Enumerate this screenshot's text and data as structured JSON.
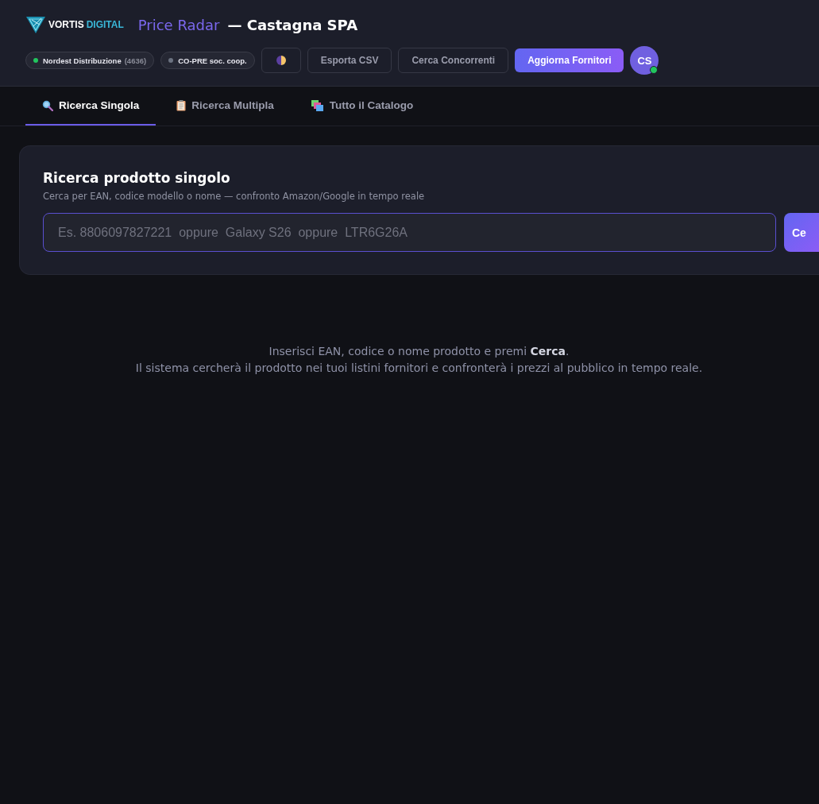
{
  "header": {
    "logo_text": [
      "VORTIS",
      "DIGITAL"
    ],
    "app_name": "Price Radar",
    "title_suffix": "— Castagna SPA",
    "suppliers": [
      {
        "name": "Nordest Distribuzione",
        "count": "(4636)",
        "color": "#22c55e"
      },
      {
        "name": "CO-PRE soc. coop.",
        "color": "#6b7280"
      }
    ],
    "actions": [
      {
        "kind": "theme"
      },
      {
        "kind": "outline",
        "label": "Esporta CSV"
      },
      {
        "kind": "outline",
        "label": "Cerca Concorrenti"
      },
      {
        "kind": "primary",
        "label": "Aggiorna Fornitori"
      }
    ],
    "avatar": {
      "initials": "CS",
      "online": true
    }
  },
  "tabs": [
    {
      "label": "Ricerca Singola",
      "kind": "search",
      "selected": true
    },
    {
      "label": "Ricerca Multipla",
      "kind": "clipboard",
      "selected": false
    },
    {
      "label": "Tutto il Catalogo",
      "kind": "stack",
      "selected": false
    }
  ],
  "search_card": {
    "title": "Ricerca prodotto singolo",
    "subtitle": "Cerca per EAN, codice modello o nome — confronto Amazon/Google in tempo reale",
    "placeholder": "Es. 8806097827221  oppure  Galaxy S26  oppure  LTR6G26A",
    "button": "Ce"
  },
  "empty_state": [
    "Inserisci EAN, codice o nome prodotto e premi **Cerca**.",
    "Il sistema cercherà il prodotto nei tuoi listini fornitori e confronterà i prezzi al pubblico in tempo reale."
  ]
}
